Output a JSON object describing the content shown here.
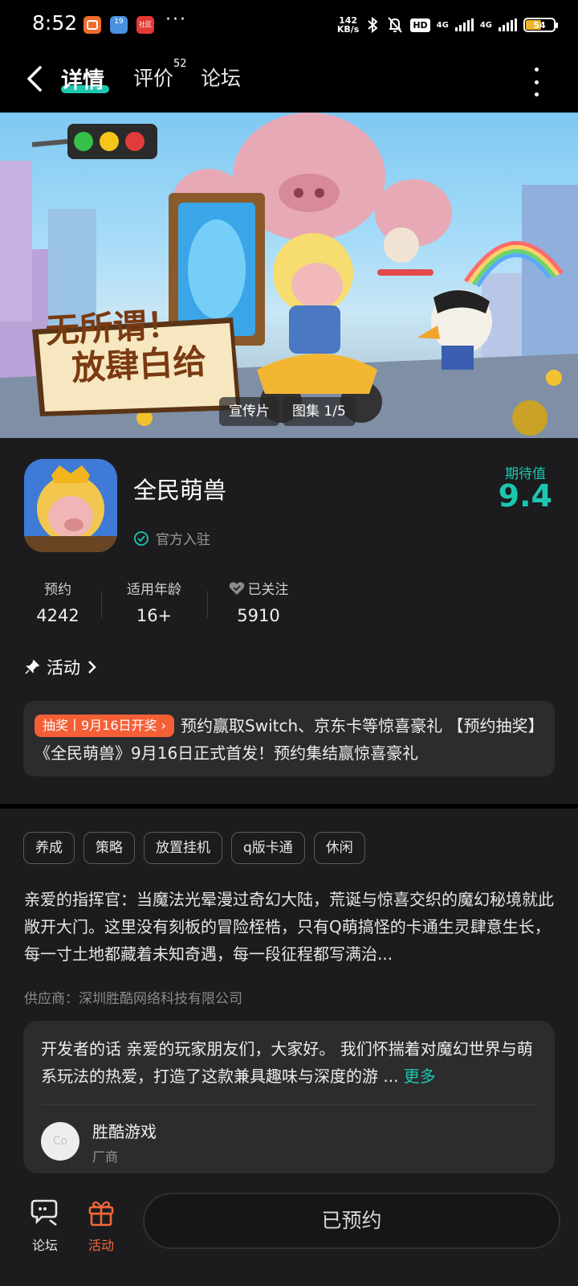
{
  "status_bar": {
    "time": "8:52",
    "more": "···",
    "net_speed_value": "142",
    "net_speed_unit": "KB/s",
    "hd": "HD",
    "sim1": "4G",
    "sim2": "4G",
    "battery": "54",
    "app_icons": [
      "red-app-icon",
      "blue-calendar-icon",
      "red-community-icon"
    ],
    "app_icon_labels": [
      "",
      "19",
      "社区"
    ]
  },
  "nav": {
    "tabs": [
      "详情",
      "评价",
      "论坛"
    ],
    "review_count": "52",
    "active_tab": "详情"
  },
  "banner": {
    "game_logo_line1": "无所谓！",
    "game_logo_line2": "放肆白给",
    "video_label": "宣传片",
    "gallery_label": "图集 1/5"
  },
  "app": {
    "name": "全民萌兽",
    "official": "官方入驻",
    "score_label": "期待值",
    "score": "9.4"
  },
  "stats": [
    {
      "label": "预约",
      "value": "4242"
    },
    {
      "label": "适用年龄",
      "value": "16+"
    },
    {
      "label": "已关注",
      "value": "5910"
    }
  ],
  "activity": {
    "title": "活动",
    "badge": "抽奖丨9月16日开奖",
    "text": "预约赢取Switch、京东卡等惊喜豪礼 【预约抽奖】《全民萌兽》9月16日正式首发！预约集结赢惊喜豪礼"
  },
  "tags": [
    "养成",
    "策略",
    "放置挂机",
    "q版卡通",
    "休闲"
  ],
  "description": "亲爱的指挥官：当魔法光晕漫过奇幻大陆，荒诞与惊喜交织的魔幻秘境就此敞开大门。这里没有刻板的冒险桎梏，只有Q萌搞怪的卡通生灵肆意生长，每一寸土地都藏着未知奇遇，每一段征程都写满治...",
  "supplier": "供应商：深圳胜酷网络科技有限公司",
  "developer": {
    "words": "开发者的话  亲爱的玩家朋友们，大家好。 我们怀揣着对魔幻世界与萌系玩法的热爱，打造了这款兼具趣味与深度的游 ...",
    "more": "更多",
    "avatar_text": "Co",
    "name": "胜酷游戏",
    "role": "厂商"
  },
  "bottom_bar": {
    "forum": "论坛",
    "activity": "活动",
    "reserve": "已预约"
  },
  "colors": {
    "accent": "#1cc7b0",
    "lottery": "#f45f36",
    "activity_icon": "#f4673a",
    "background": "#1c1c1e"
  }
}
